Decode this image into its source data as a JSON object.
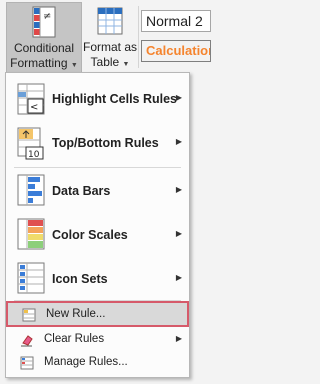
{
  "ribbon": {
    "conditional_formatting_line1": "Conditional",
    "conditional_formatting_line2": "Formatting",
    "format_as_table_line1": "Format as",
    "format_as_table_line2": "Table",
    "style_normal": "Normal 2",
    "style_calculation": "Calculation"
  },
  "menu": {
    "items": [
      {
        "label": "Highlight Cells Rules",
        "icon": "highlight-cells-icon",
        "submenu": true
      },
      {
        "label": "Top/Bottom Rules",
        "icon": "top-bottom-icon",
        "submenu": true
      },
      {
        "label": "Data Bars",
        "icon": "data-bars-icon",
        "submenu": true
      },
      {
        "label": "Color Scales",
        "icon": "color-scales-icon",
        "submenu": true
      },
      {
        "label": "Icon Sets",
        "icon": "icon-sets-icon",
        "submenu": true
      }
    ],
    "new_rule": "New Rule...",
    "clear_rules": "Clear Rules",
    "manage_rules": "Manage Rules..."
  },
  "colors": {
    "hover_outline": "#d65a6a",
    "calculation_text": "#f5842e"
  }
}
